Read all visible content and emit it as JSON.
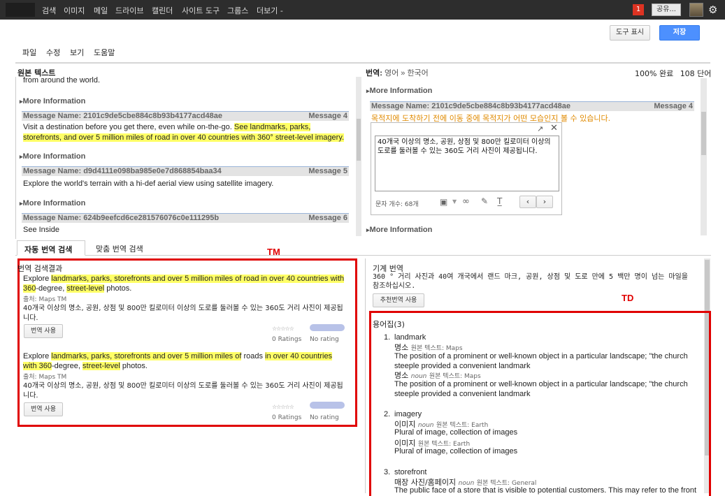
{
  "topnav": {
    "items": [
      "검색",
      "이미지",
      "메일",
      "드라이브",
      "캘린더",
      "사이트 도구",
      "그룹스",
      "더보기 -"
    ],
    "notification_count": "1",
    "share_label": "공유..."
  },
  "toolbar": {
    "show_tools_label": "도구 표시",
    "save_label": "저장"
  },
  "menu": [
    "파일",
    "수정",
    "보기",
    "도움말"
  ],
  "source_panel": {
    "title": "원본 텍스트",
    "cutoff_text": "from around the world.",
    "more_info": "More Information",
    "messages": [
      {
        "name": "Message Name: 2101c9de5cbe884c8b93b4177acd48ae",
        "num": "Message 4",
        "text_parts": [
          "Visit a destination before you get there, even while on-the-go. ",
          "See landmarks, parks, storefronts, and over 5 million miles of road in over 40 countries with 360° street-level imagery."
        ]
      },
      {
        "name": "Message Name: d9d4111e098ba985e0e7d868854baa34",
        "num": "Message 5",
        "text": "Explore the world's terrain with a hi-def aerial view using satellite imagery."
      },
      {
        "name": "Message Name: 624b9eefcd6ce281576076c0e111295b",
        "num": "Message 6",
        "text": "See Inside"
      }
    ]
  },
  "translation_panel": {
    "label": "번역:",
    "lang": "영어 » 한국어",
    "progress": "100% 완료",
    "words": "108 단어",
    "more_info": "More Information",
    "message_name": "Message Name: 2101c9de5cbe884c8b93b4177acd48ae",
    "message_num": "Message 4",
    "prev_translation": "목적지에 도착하기 전에 이동 중에 목적지가 어떤 모습인지 볼 수 있습니다.",
    "editor_text": "40개국 이상의 명소, 공원, 상점 및 800만 킬로미터 이상의 도로를 둘러볼 수 있는 360도 거리 사진이 제공됩니다.",
    "char_count": "문자 개수: 68개"
  },
  "search_tabs": [
    "자동 번역 검색",
    "맞춤 번역 검색"
  ],
  "tm": {
    "annotation": "TM",
    "title": "번역 검색결과",
    "results": [
      {
        "source_parts": [
          [
            "Explore ",
            false
          ],
          [
            "landmarks, parks, storefronts and over 5 million miles of road in over 40 countries with 360",
            true
          ],
          [
            "-degree, ",
            false
          ],
          [
            "street-level",
            true
          ],
          [
            " photos.",
            false
          ]
        ],
        "source_label": "출처: Maps TM",
        "translation": "40개국 이상의 명소, 공원, 상점 및 800만 킬로미터 이상의 도로를 둘러볼 수 있는 360도 거리 사진이 제공됩니다.",
        "use_label": "번역 사용",
        "ratings": "0 Ratings",
        "no_rating": "No rating"
      },
      {
        "source_parts": [
          [
            "Explore ",
            false
          ],
          [
            "landmarks, parks, storefronts and over 5 million miles of",
            true
          ],
          [
            " roads ",
            false
          ],
          [
            "in over 40 countries with 360",
            true
          ],
          [
            "-degree, ",
            false
          ],
          [
            "street-level",
            true
          ],
          [
            " photos.",
            false
          ]
        ],
        "source_label": "출처: Maps TM",
        "translation": "40개국 이상의 명소, 공원, 상점 및 800만 킬로미터 이상의 도로를 둘러볼 수 있는 360도 거리 사진이 제공됩니다.",
        "use_label": "번역 사용",
        "ratings": "0 Ratings",
        "no_rating": "No rating"
      }
    ]
  },
  "machine_translation": {
    "title": "기계 번역",
    "text": "360 ° 거리 사진과 40여 개국에서 랜드 마크, 공원, 상점 및 도로 만에 5 백만 명이 넘는 마일을 참조하십시오.",
    "use_label": "추천번역 사용"
  },
  "td": {
    "annotation": "TD",
    "title": "용어집(3)",
    "entries": [
      {
        "num": "1.",
        "term": "landmark",
        "defs": [
          {
            "word": "명소",
            "pos": "",
            "src": "원본 텍스트: Maps",
            "desc": "The position of a prominent or well-known object in a particular landscape; \"the church steeple provided a convenient landmark"
          },
          {
            "word": "명소",
            "pos": "noun",
            "src": "원본 텍스트: Maps",
            "desc": "The position of a prominent or well-known object in a particular landscape; \"the church steeple provided a convenient landmark"
          }
        ]
      },
      {
        "num": "2.",
        "term": "imagery",
        "defs": [
          {
            "word": "이미지",
            "pos": "noun",
            "src": "원본 텍스트: Earth",
            "desc": "Plural of image, collection of images"
          },
          {
            "word": "이미지",
            "pos": "",
            "src": "원본 텍스트: Earth",
            "desc": "Plural of image, collection of images"
          }
        ]
      },
      {
        "num": "3.",
        "term": "storefront",
        "defs": [
          {
            "word": "매장 사진/홈페이지",
            "pos": "noun",
            "src": "원본 텍스트: General",
            "desc": "The public face of a store that is visible to potential customers. This may refer to the front"
          }
        ]
      }
    ]
  },
  "colors": {
    "accent_blue": "#4d90fe",
    "highlight": "#ffff66",
    "annotation_red": "#e00000",
    "orange_text": "#e08a00"
  }
}
